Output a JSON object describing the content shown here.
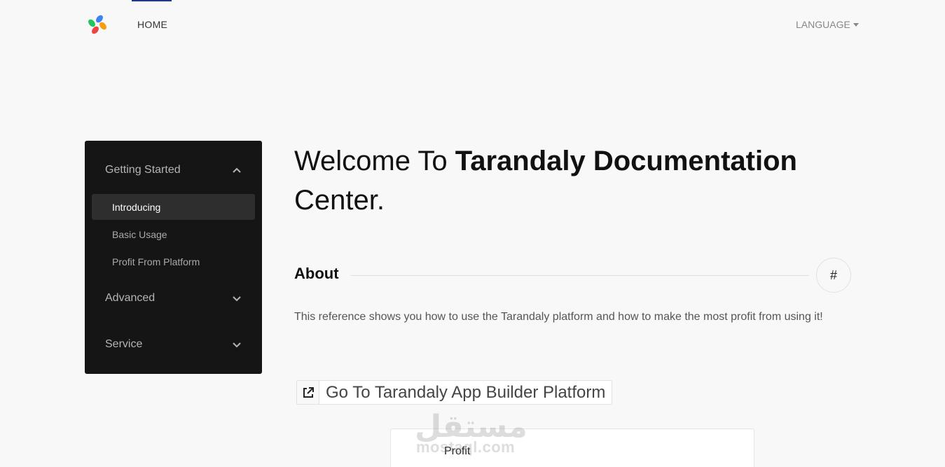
{
  "nav": {
    "home_label": "HOME",
    "language_label": "LANGUAGE"
  },
  "sidebar": {
    "sections": [
      {
        "label": "Getting Started",
        "expanded": true,
        "items": [
          {
            "label": "Introducing",
            "active": true
          },
          {
            "label": "Basic Usage",
            "active": false
          },
          {
            "label": "Profit From Platform",
            "active": false
          }
        ]
      },
      {
        "label": "Advanced",
        "expanded": false
      },
      {
        "label": "Service",
        "expanded": false
      }
    ]
  },
  "main": {
    "title_light": "Welcome To ",
    "title_bold": "Tarandaly Documentation",
    "title_tail": "Center.",
    "about_heading": "About",
    "anchor_symbol": "#",
    "about_text": "This reference shows you how to use the Tarandaly platform and how to make the most profit from using it!",
    "platform_link_label": "Go To Tarandaly App Builder Platform",
    "profit_card_label": "Profit"
  },
  "watermark": {
    "arabic": "مستقل",
    "latin": "mostaql.com"
  },
  "colors": {
    "background": "#f8f8f8",
    "sidebar_bg": "#151515",
    "sidebar_active_bg": "#2e2e2e",
    "nav_active_indicator": "#1f3a8a"
  },
  "icons": {
    "logo": "tarandaly-logo",
    "language_caret": "caret-down-icon",
    "section_expanded": "chevron-up-icon",
    "section_collapsed": "chevron-down-icon",
    "external_link": "external-link-icon"
  }
}
